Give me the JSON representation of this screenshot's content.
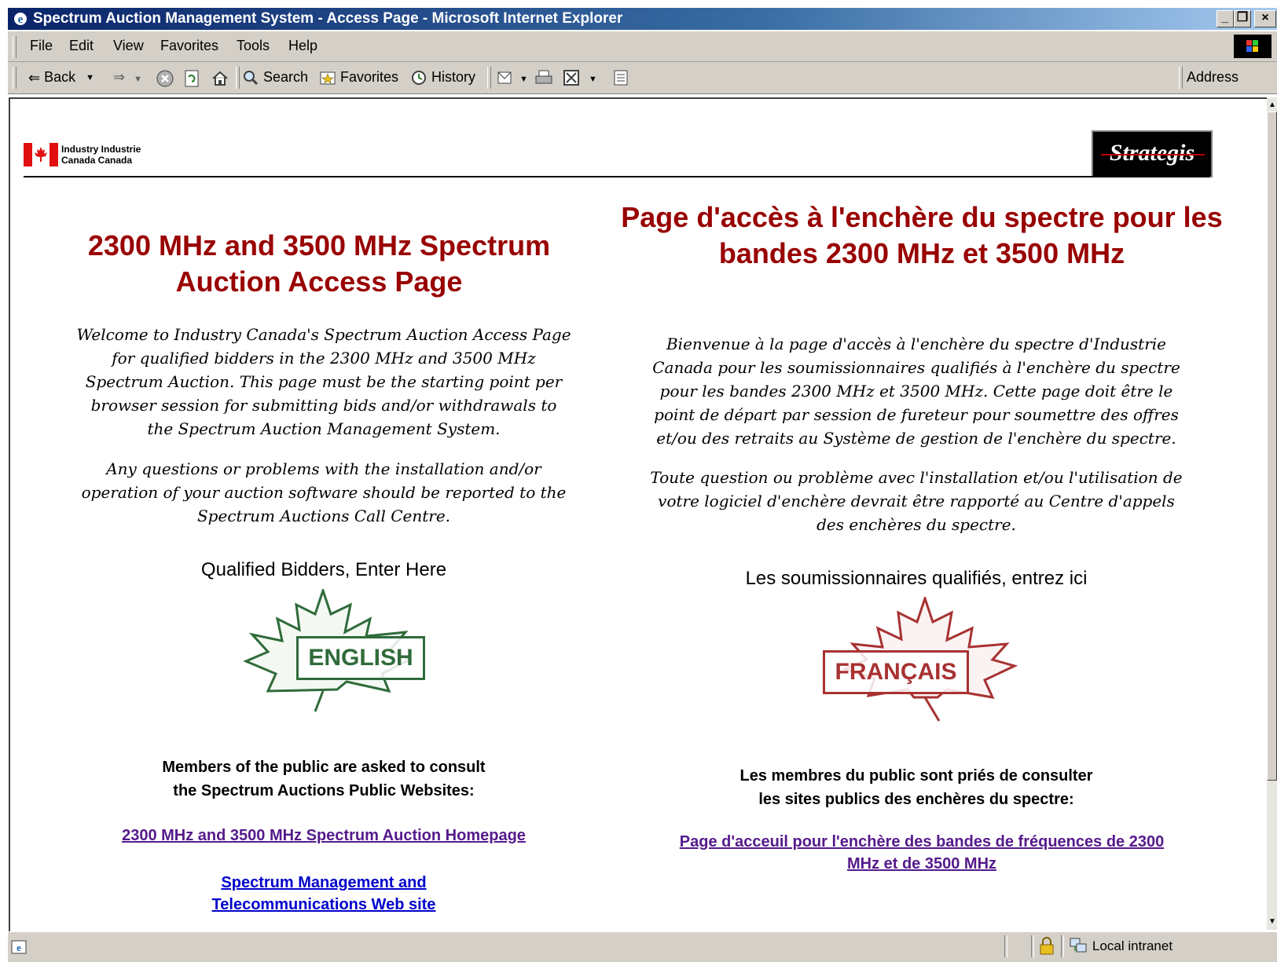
{
  "window": {
    "title": "Spectrum Auction Management System - Access Page - Microsoft Internet Explorer",
    "controls": {
      "minimize": "_",
      "restore": "❐",
      "close": "×"
    }
  },
  "menubar": [
    "File",
    "Edit",
    "View",
    "Favorites",
    "Tools",
    "Help"
  ],
  "toolbar": {
    "back": "Back",
    "search": "Search",
    "favorites": "Favorites",
    "history": "History",
    "address_label": "Address"
  },
  "header": {
    "logo_text_line1": "Industry Industrie",
    "logo_text_line2": "Canada  Canada",
    "strategis": "Strategis"
  },
  "english": {
    "title": "2300 MHz and 3500 MHz Spectrum Auction Access Page",
    "welcome": "Welcome to Industry Canada's Spectrum Auction Access Page for qualified bidders in the 2300 MHz and 3500 MHz Spectrum Auction. This page must be the starting point per browser session for submitting bids and/or withdrawals to the Spectrum Auction Management System.",
    "questions": "Any questions or problems with the installation and/or operation of your auction software should be reported to the Spectrum Auctions Call Centre.",
    "enter_here": "Qualified Bidders, Enter Here",
    "leaf_label": "ENGLISH",
    "public_line1": "Members of the public are asked to consult",
    "public_line2": "the Spectrum Auctions Public Websites:",
    "link_home": "2300 MHz and 3500 MHz Spectrum Auction Homepage",
    "link_sm_line1": "Spectrum Management and",
    "link_sm_line2": "Telecommunications Web site"
  },
  "french": {
    "title": "Page d'accès à l'enchère du spectre pour les bandes 2300 MHz et 3500 MHz",
    "welcome": "Bienvenue à la page d'accès à l'enchère du spectre d'Industrie Canada pour les soumissionnaires qualifiés à l'enchère du spectre pour les bandes 2300 MHz et 3500 MHz. Cette page doit être le point de départ par session de fureteur pour soumettre des offres et/ou des retraits au Système de gestion de l'enchère du spectre.",
    "questions": "Toute question ou problème avec l'installation et/ou l'utilisation de votre logiciel d'enchère devrait être rapporté au Centre d'appels des enchères du spectre.",
    "enter_here": "Les soumissionnaires qualifiés, entrez ici",
    "leaf_label": "FRANÇAIS",
    "public_line1": "Les membres du public sont priés de consulter",
    "public_line2": "les sites publics des enchères du spectre:",
    "link_home": "Page d'acceuil pour l'enchère des bandes de fréquences de 2300 MHz et de 3500 MHz"
  },
  "statusbar": {
    "zone": "Local intranet"
  },
  "colors": {
    "heading_red": "#990000",
    "leaf_green": "#2f6b3a",
    "leaf_red": "#a83232",
    "visited_link": "#551a8b",
    "link_blue": "#0000cc"
  }
}
